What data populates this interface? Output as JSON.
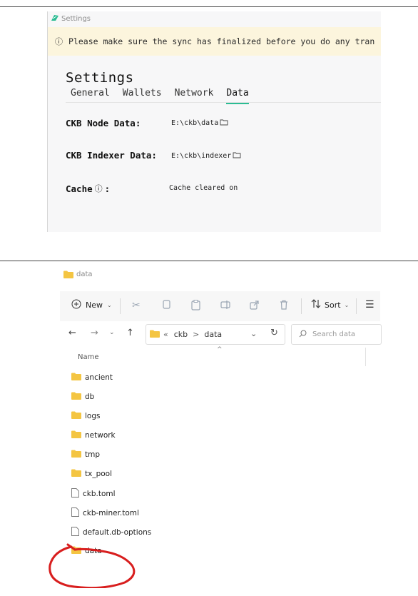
{
  "settings_window": {
    "title": "Settings",
    "warning": "Please make sure the sync has finalized before you do any tran",
    "heading": "Settings",
    "tabs": [
      {
        "label": "General",
        "active": false
      },
      {
        "label": "Wallets",
        "active": false
      },
      {
        "label": "Network",
        "active": false
      },
      {
        "label": "Data",
        "active": true
      }
    ],
    "rows": {
      "node_label": "CKB Node Data:",
      "node_value": "E:\\ckb\\data",
      "indexer_label": "CKB Indexer Data:",
      "indexer_value": "E:\\ckb\\indexer",
      "cache_label": "Cache",
      "cache_colon": ":",
      "cache_value": "Cache cleared on"
    },
    "colors": {
      "accent": "#2bbc93",
      "warning_bg": "#fcf5dd"
    }
  },
  "explorer": {
    "title": "data",
    "ribbon": {
      "new_label": "New",
      "sort_label": "Sort"
    },
    "address": {
      "overflow": "«",
      "segments": [
        "ckb",
        "data"
      ],
      "separator": ">"
    },
    "search_placeholder": "Search data",
    "column_name": "Name",
    "items": [
      {
        "name": "ancient",
        "type": "folder"
      },
      {
        "name": "db",
        "type": "folder"
      },
      {
        "name": "logs",
        "type": "folder"
      },
      {
        "name": "network",
        "type": "folder"
      },
      {
        "name": "tmp",
        "type": "folder"
      },
      {
        "name": "tx_pool",
        "type": "folder"
      },
      {
        "name": "ckb.toml",
        "type": "file"
      },
      {
        "name": "ckb-miner.toml",
        "type": "file"
      },
      {
        "name": "default.db-options",
        "type": "file"
      },
      {
        "name": "data",
        "type": "folder"
      }
    ],
    "colors": {
      "folder": "#f4c542",
      "annotation": "#d81e1e"
    }
  }
}
